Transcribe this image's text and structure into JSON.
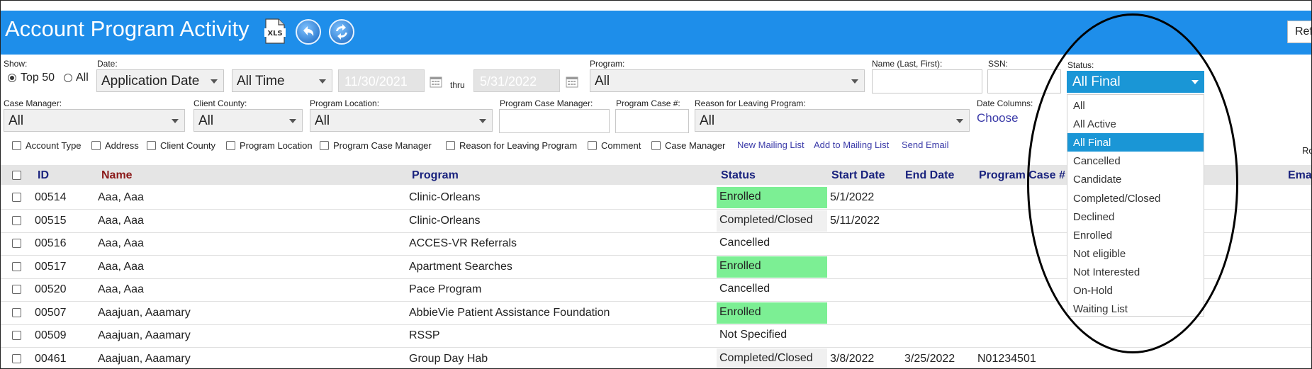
{
  "header": {
    "title": "Account Program Activity",
    "refresh_label": "Ref"
  },
  "filters": {
    "show_label": "Show:",
    "top50_label": "Top 50",
    "all_label": "All",
    "date_label": "Date:",
    "date_type": "Application Date",
    "date_range": "All Time",
    "from_date": "11/30/2021",
    "thru_label": "thru",
    "to_date": "5/31/2022",
    "program_label": "Program:",
    "program_value": "All",
    "name_label": "Name (Last, First):",
    "ssn_label": "SSN:",
    "status_label": "Status:",
    "case_manager_label": "Case Manager:",
    "case_manager_value": "All",
    "client_county_label": "Client County:",
    "client_county_value": "All",
    "program_location_label": "Program Location:",
    "program_location_value": "All",
    "program_case_manager_label": "Program Case Manager:",
    "program_case_number_label": "Program Case #:",
    "reason_label": "Reason for Leaving Program:",
    "reason_value": "All",
    "date_columns_label": "Date Columns:",
    "choose_label": "Choose"
  },
  "columns_options": [
    "Account Type",
    "Address",
    "Client County",
    "Program Location",
    "Program Case Manager",
    "Reason for Leaving Program",
    "Comment",
    "Case Manager"
  ],
  "links": {
    "new_mailing_list": "New Mailing List",
    "add_to_mailing_list": "Add to Mailing List",
    "send_email": "Send Email",
    "ro": "Ro"
  },
  "table": {
    "headers": {
      "id": "ID",
      "name": "Name",
      "program": "Program",
      "status": "Status",
      "start_date": "Start Date",
      "end_date": "End Date",
      "program_case": "Program Case #",
      "email": "Ema"
    },
    "rows": [
      {
        "id": "00514",
        "name": "Aaa, Aaa",
        "program": "Clinic-Orleans",
        "status": "Enrolled",
        "start": "5/1/2022",
        "end": "",
        "case": ""
      },
      {
        "id": "00515",
        "name": "Aaa, Aaa",
        "program": "Clinic-Orleans",
        "status": "Completed/Closed",
        "start": "5/11/2022",
        "end": "",
        "case": ""
      },
      {
        "id": "00516",
        "name": "Aaa, Aaa",
        "program": "ACCES-VR Referrals",
        "status": "Cancelled",
        "start": "",
        "end": "",
        "case": ""
      },
      {
        "id": "00517",
        "name": "Aaa, Aaa",
        "program": "Apartment Searches",
        "status": "Enrolled",
        "start": "",
        "end": "",
        "case": ""
      },
      {
        "id": "00520",
        "name": "Aaa, Aaa",
        "program": "Pace Program",
        "status": "Cancelled",
        "start": "",
        "end": "",
        "case": ""
      },
      {
        "id": "00507",
        "name": "Aaajuan, Aaamary",
        "program": "AbbieVie Patient Assistance Foundation",
        "status": "Enrolled",
        "start": "",
        "end": "",
        "case": ""
      },
      {
        "id": "00509",
        "name": "Aaajuan, Aaamary",
        "program": "RSSP",
        "status": "Not Specified",
        "start": "",
        "end": "",
        "case": ""
      },
      {
        "id": "00461",
        "name": "Aaajuan, Aaamary",
        "program": "Group Day Hab",
        "status": "Completed/Closed",
        "start": "3/8/2022",
        "end": "3/25/2022",
        "case": "N01234501"
      }
    ]
  },
  "status_dropdown": {
    "selected": "All Final",
    "options": [
      "All",
      "All Active",
      "All Final",
      "Cancelled",
      "Candidate",
      "Completed/Closed",
      "Declined",
      "Enrolled",
      "Not eligible",
      "Not Interested",
      "On-Hold",
      "Waiting List"
    ]
  },
  "colors": {
    "header_blue": "#1e8eea",
    "enrolled_green": "#7cef94",
    "dropdown_blue": "#1a96d6"
  }
}
